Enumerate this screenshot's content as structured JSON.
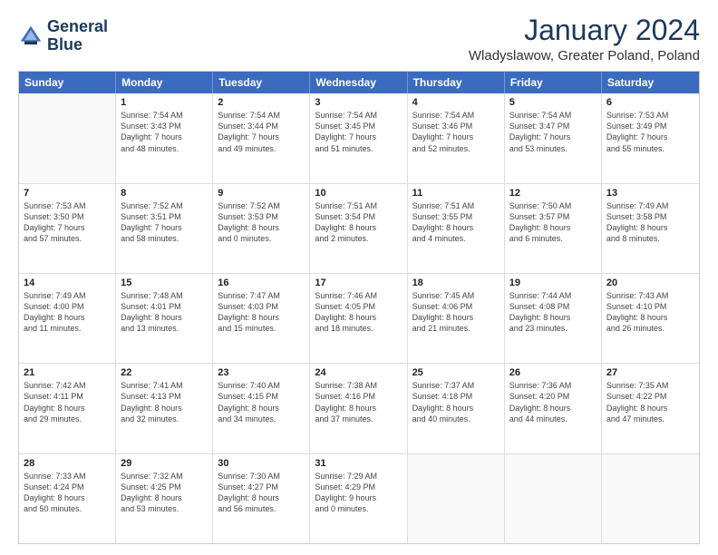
{
  "logo": {
    "line1": "General",
    "line2": "Blue"
  },
  "title": "January 2024",
  "location": "Wladyslawow, Greater Poland, Poland",
  "header_days": [
    "Sunday",
    "Monday",
    "Tuesday",
    "Wednesday",
    "Thursday",
    "Friday",
    "Saturday"
  ],
  "weeks": [
    [
      {
        "day": "",
        "lines": []
      },
      {
        "day": "1",
        "lines": [
          "Sunrise: 7:54 AM",
          "Sunset: 3:43 PM",
          "Daylight: 7 hours",
          "and 48 minutes."
        ]
      },
      {
        "day": "2",
        "lines": [
          "Sunrise: 7:54 AM",
          "Sunset: 3:44 PM",
          "Daylight: 7 hours",
          "and 49 minutes."
        ]
      },
      {
        "day": "3",
        "lines": [
          "Sunrise: 7:54 AM",
          "Sunset: 3:45 PM",
          "Daylight: 7 hours",
          "and 51 minutes."
        ]
      },
      {
        "day": "4",
        "lines": [
          "Sunrise: 7:54 AM",
          "Sunset: 3:46 PM",
          "Daylight: 7 hours",
          "and 52 minutes."
        ]
      },
      {
        "day": "5",
        "lines": [
          "Sunrise: 7:54 AM",
          "Sunset: 3:47 PM",
          "Daylight: 7 hours",
          "and 53 minutes."
        ]
      },
      {
        "day": "6",
        "lines": [
          "Sunrise: 7:53 AM",
          "Sunset: 3:49 PM",
          "Daylight: 7 hours",
          "and 55 minutes."
        ]
      }
    ],
    [
      {
        "day": "7",
        "lines": [
          "Sunrise: 7:53 AM",
          "Sunset: 3:50 PM",
          "Daylight: 7 hours",
          "and 57 minutes."
        ]
      },
      {
        "day": "8",
        "lines": [
          "Sunrise: 7:52 AM",
          "Sunset: 3:51 PM",
          "Daylight: 7 hours",
          "and 58 minutes."
        ]
      },
      {
        "day": "9",
        "lines": [
          "Sunrise: 7:52 AM",
          "Sunset: 3:53 PM",
          "Daylight: 8 hours",
          "and 0 minutes."
        ]
      },
      {
        "day": "10",
        "lines": [
          "Sunrise: 7:51 AM",
          "Sunset: 3:54 PM",
          "Daylight: 8 hours",
          "and 2 minutes."
        ]
      },
      {
        "day": "11",
        "lines": [
          "Sunrise: 7:51 AM",
          "Sunset: 3:55 PM",
          "Daylight: 8 hours",
          "and 4 minutes."
        ]
      },
      {
        "day": "12",
        "lines": [
          "Sunrise: 7:50 AM",
          "Sunset: 3:57 PM",
          "Daylight: 8 hours",
          "and 6 minutes."
        ]
      },
      {
        "day": "13",
        "lines": [
          "Sunrise: 7:49 AM",
          "Sunset: 3:58 PM",
          "Daylight: 8 hours",
          "and 8 minutes."
        ]
      }
    ],
    [
      {
        "day": "14",
        "lines": [
          "Sunrise: 7:49 AM",
          "Sunset: 4:00 PM",
          "Daylight: 8 hours",
          "and 11 minutes."
        ]
      },
      {
        "day": "15",
        "lines": [
          "Sunrise: 7:48 AM",
          "Sunset: 4:01 PM",
          "Daylight: 8 hours",
          "and 13 minutes."
        ]
      },
      {
        "day": "16",
        "lines": [
          "Sunrise: 7:47 AM",
          "Sunset: 4:03 PM",
          "Daylight: 8 hours",
          "and 15 minutes."
        ]
      },
      {
        "day": "17",
        "lines": [
          "Sunrise: 7:46 AM",
          "Sunset: 4:05 PM",
          "Daylight: 8 hours",
          "and 18 minutes."
        ]
      },
      {
        "day": "18",
        "lines": [
          "Sunrise: 7:45 AM",
          "Sunset: 4:06 PM",
          "Daylight: 8 hours",
          "and 21 minutes."
        ]
      },
      {
        "day": "19",
        "lines": [
          "Sunrise: 7:44 AM",
          "Sunset: 4:08 PM",
          "Daylight: 8 hours",
          "and 23 minutes."
        ]
      },
      {
        "day": "20",
        "lines": [
          "Sunrise: 7:43 AM",
          "Sunset: 4:10 PM",
          "Daylight: 8 hours",
          "and 26 minutes."
        ]
      }
    ],
    [
      {
        "day": "21",
        "lines": [
          "Sunrise: 7:42 AM",
          "Sunset: 4:11 PM",
          "Daylight: 8 hours",
          "and 29 minutes."
        ]
      },
      {
        "day": "22",
        "lines": [
          "Sunrise: 7:41 AM",
          "Sunset: 4:13 PM",
          "Daylight: 8 hours",
          "and 32 minutes."
        ]
      },
      {
        "day": "23",
        "lines": [
          "Sunrise: 7:40 AM",
          "Sunset: 4:15 PM",
          "Daylight: 8 hours",
          "and 34 minutes."
        ]
      },
      {
        "day": "24",
        "lines": [
          "Sunrise: 7:38 AM",
          "Sunset: 4:16 PM",
          "Daylight: 8 hours",
          "and 37 minutes."
        ]
      },
      {
        "day": "25",
        "lines": [
          "Sunrise: 7:37 AM",
          "Sunset: 4:18 PM",
          "Daylight: 8 hours",
          "and 40 minutes."
        ]
      },
      {
        "day": "26",
        "lines": [
          "Sunrise: 7:36 AM",
          "Sunset: 4:20 PM",
          "Daylight: 8 hours",
          "and 44 minutes."
        ]
      },
      {
        "day": "27",
        "lines": [
          "Sunrise: 7:35 AM",
          "Sunset: 4:22 PM",
          "Daylight: 8 hours",
          "and 47 minutes."
        ]
      }
    ],
    [
      {
        "day": "28",
        "lines": [
          "Sunrise: 7:33 AM",
          "Sunset: 4:24 PM",
          "Daylight: 8 hours",
          "and 50 minutes."
        ]
      },
      {
        "day": "29",
        "lines": [
          "Sunrise: 7:32 AM",
          "Sunset: 4:25 PM",
          "Daylight: 8 hours",
          "and 53 minutes."
        ]
      },
      {
        "day": "30",
        "lines": [
          "Sunrise: 7:30 AM",
          "Sunset: 4:27 PM",
          "Daylight: 8 hours",
          "and 56 minutes."
        ]
      },
      {
        "day": "31",
        "lines": [
          "Sunrise: 7:29 AM",
          "Sunset: 4:29 PM",
          "Daylight: 9 hours",
          "and 0 minutes."
        ]
      },
      {
        "day": "",
        "lines": []
      },
      {
        "day": "",
        "lines": []
      },
      {
        "day": "",
        "lines": []
      }
    ]
  ]
}
